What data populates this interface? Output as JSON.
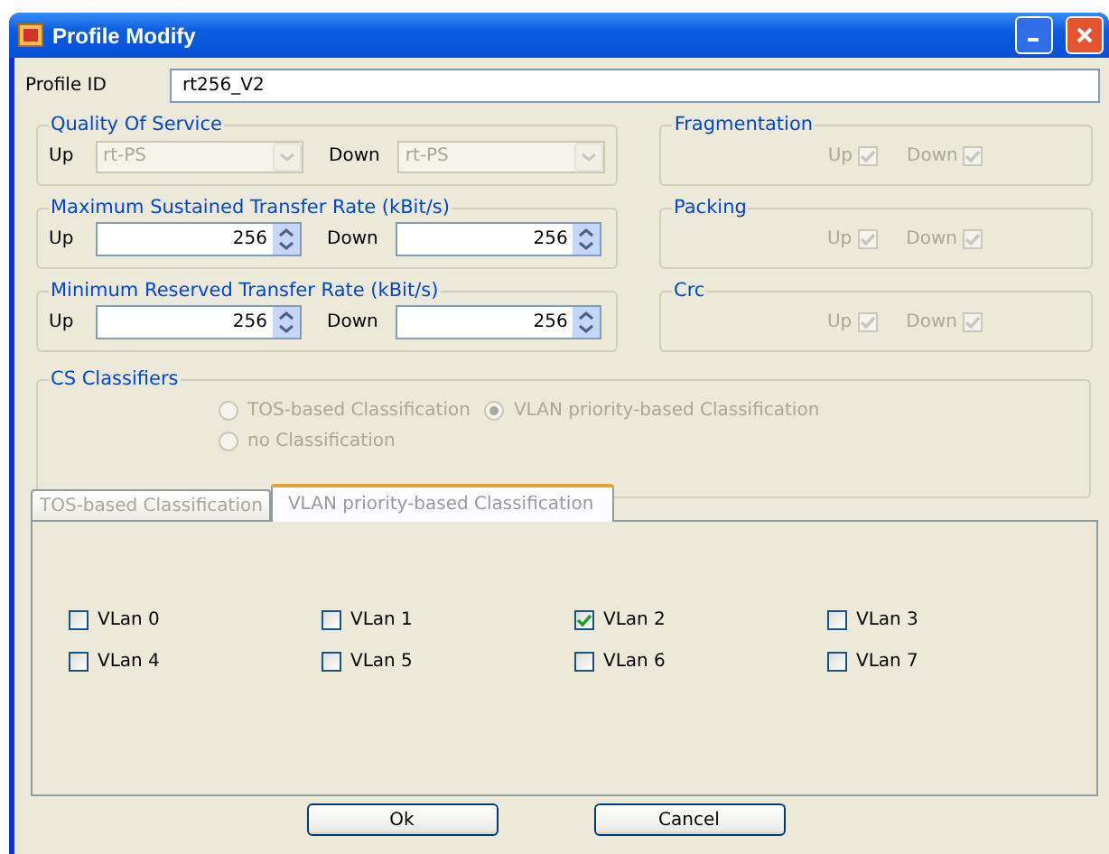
{
  "window": {
    "title": "Profile Modify"
  },
  "profile_id": {
    "label": "Profile ID",
    "value": "rt256_V2"
  },
  "groups": [
    {
      "kind": "dropdowns",
      "title": "Quality Of Service",
      "fields": [
        {
          "label": "Up",
          "value": "rt-PS",
          "disabled": true
        },
        {
          "label": "Down",
          "value": "rt-PS",
          "disabled": true
        }
      ],
      "side": {
        "title": "Fragmentation",
        "checks": [
          {
            "label": "Up",
            "checked": true,
            "disabled": true
          },
          {
            "label": "Down",
            "checked": true,
            "disabled": true
          }
        ]
      }
    },
    {
      "kind": "spinners",
      "title": "Maximum Sustained Transfer Rate (kBit/s)",
      "fields": [
        {
          "label": "Up",
          "value": "256",
          "disabled": false
        },
        {
          "label": "Down",
          "value": "256",
          "disabled": false
        }
      ],
      "side": {
        "title": "Packing",
        "checks": [
          {
            "label": "Up",
            "checked": true,
            "disabled": true
          },
          {
            "label": "Down",
            "checked": true,
            "disabled": true
          }
        ]
      }
    },
    {
      "kind": "spinners",
      "title": "Minimum Reserved Transfer Rate (kBit/s)",
      "fields": [
        {
          "label": "Up",
          "value": "256",
          "disabled": false
        },
        {
          "label": "Down",
          "value": "256",
          "disabled": false
        }
      ],
      "side": {
        "title": "Crc",
        "checks": [
          {
            "label": "Up",
            "checked": true,
            "disabled": true
          },
          {
            "label": "Down",
            "checked": true,
            "disabled": true
          }
        ]
      }
    }
  ],
  "cs_classifiers": {
    "title": "CS Classifiers",
    "options": [
      {
        "label": "TOS-based Classification",
        "selected": false,
        "disabled": true
      },
      {
        "label": "VLAN priority-based Classification",
        "selected": true,
        "disabled": true
      },
      {
        "label": "no Classification",
        "selected": false,
        "disabled": true
      }
    ]
  },
  "tabs": [
    {
      "label": "TOS-based Classification",
      "selected": false
    },
    {
      "label": "VLAN priority-based Classification",
      "selected": true
    }
  ],
  "vlans": [
    {
      "label": "VLan 0",
      "checked": false
    },
    {
      "label": "VLan 1",
      "checked": false
    },
    {
      "label": "VLan 2",
      "checked": true
    },
    {
      "label": "VLan 3",
      "checked": false
    },
    {
      "label": "VLan 4",
      "checked": false
    },
    {
      "label": "VLan 5",
      "checked": false
    },
    {
      "label": "VLan 6",
      "checked": false
    },
    {
      "label": "VLan 7",
      "checked": false
    }
  ],
  "buttons": [
    "Ok",
    "Cancel"
  ]
}
